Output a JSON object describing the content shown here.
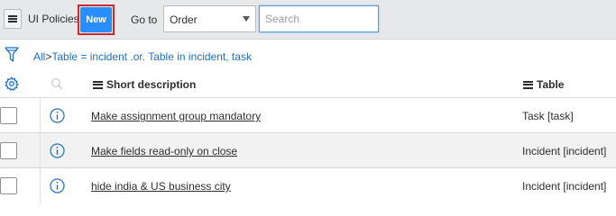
{
  "header": {
    "list_title": "UI Policies",
    "new_label": "New",
    "goto_label": "Go to",
    "goto_selected": "Order",
    "search_placeholder": "Search"
  },
  "breadcrumb": {
    "all": "All",
    "separator": ">",
    "filter": "Table = incident .or. Table in incident, task"
  },
  "columns": {
    "short_description": "Short description",
    "table": "Table"
  },
  "rows": [
    {
      "short_description": "Make assignment group mandatory",
      "table": "Task [task]"
    },
    {
      "short_description": "Make fields read-only on close",
      "table": "Incident [incident]"
    },
    {
      "short_description": "hide india & US business city",
      "table": "Incident [incident]"
    }
  ],
  "colors": {
    "accent": "#278efc",
    "highlight_border": "#d22828",
    "link_blue": "#1f6fc5",
    "header_bg": "#e6e8ea"
  },
  "icons": {
    "menu": "hamburger-icon",
    "filter": "funnel-icon",
    "settings": "gear-icon",
    "column_search": "search-icon",
    "row_info": "info-icon"
  }
}
